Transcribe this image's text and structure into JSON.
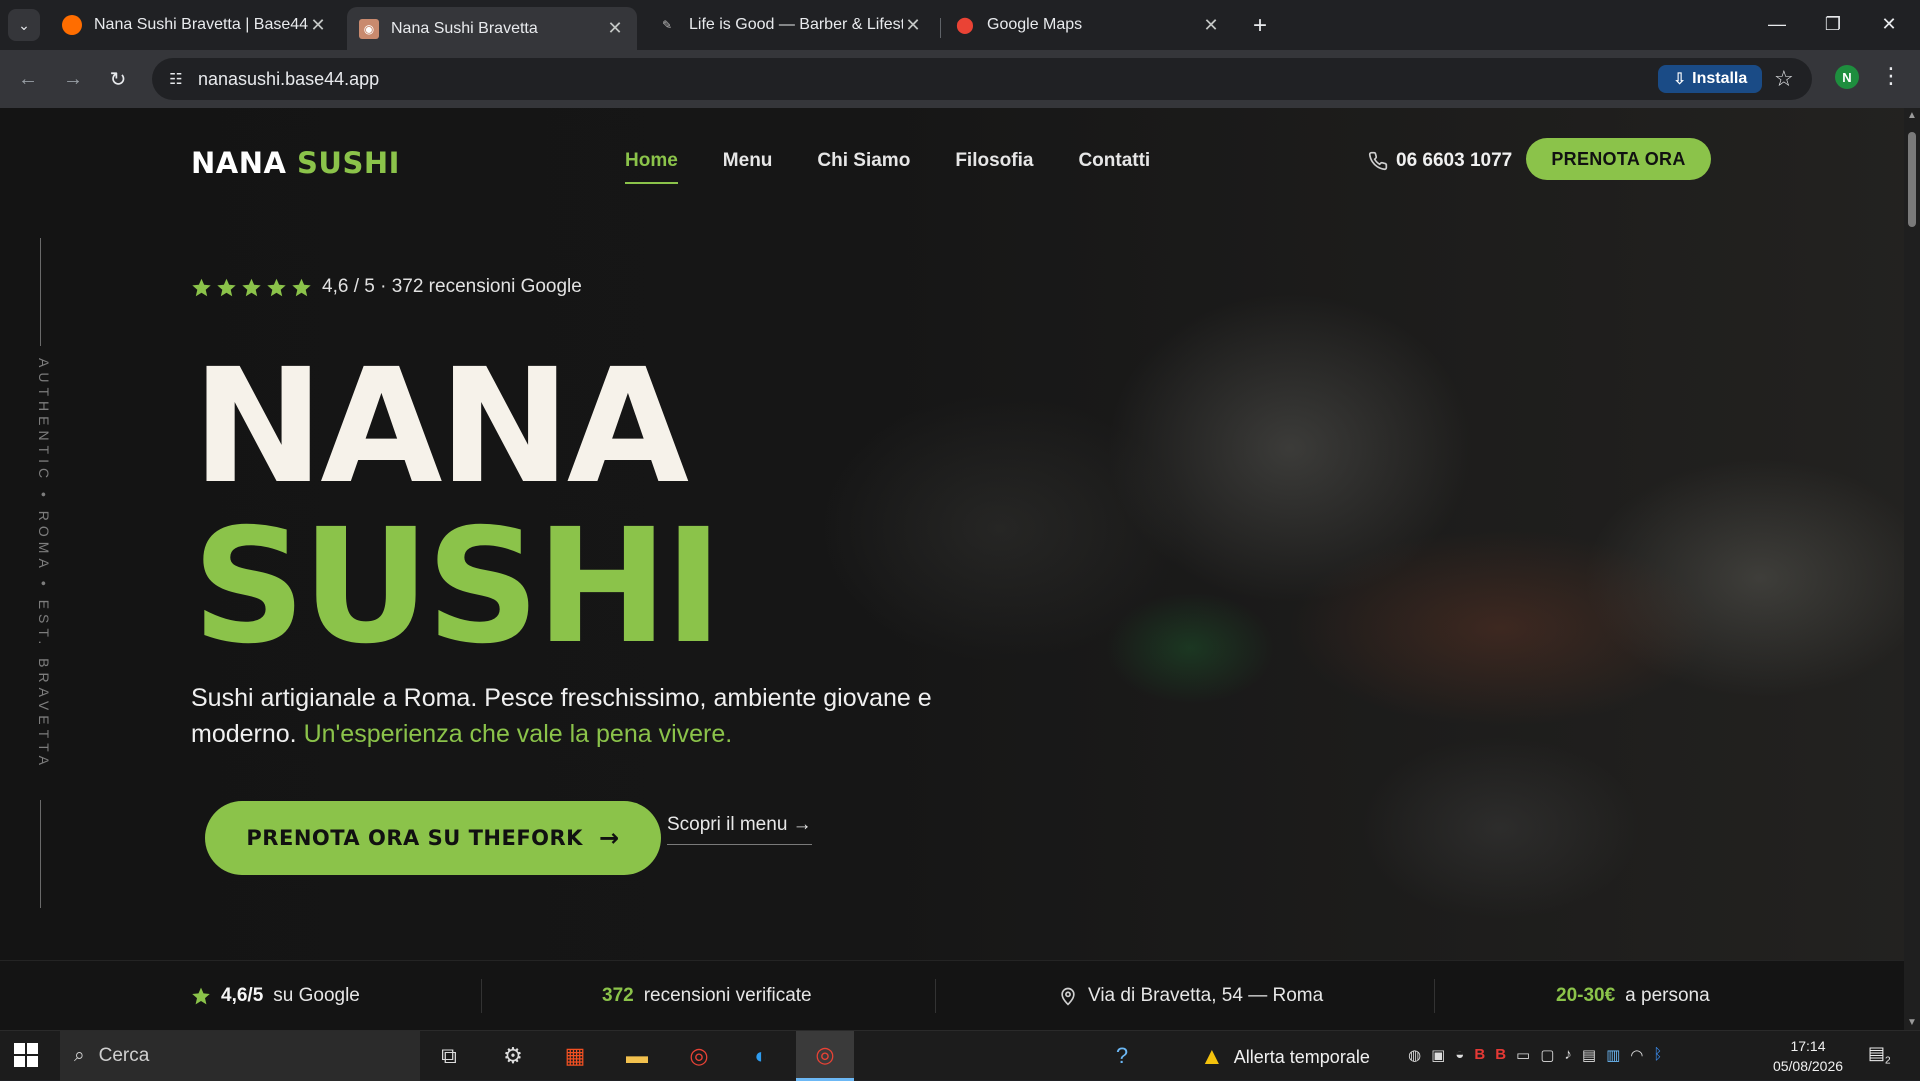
{
  "browser": {
    "tabs": [
      {
        "title": "Nana Sushi Bravetta | Base44",
        "active": false
      },
      {
        "title": "Nana Sushi Bravetta",
        "active": true
      },
      {
        "title": "Life is Good — Barber & Lifestyle",
        "active": false
      },
      {
        "title": "Google Maps",
        "active": false
      }
    ],
    "url": "nanasushi.base44.app",
    "install_label": "Installa",
    "profile_initial": "N"
  },
  "site": {
    "logo_primary": "NANA",
    "logo_accent": "SUSHI",
    "nav": [
      {
        "label": "Home",
        "active": true
      },
      {
        "label": "Menu",
        "active": false
      },
      {
        "label": "Chi Siamo",
        "active": false
      },
      {
        "label": "Filosofia",
        "active": false
      },
      {
        "label": "Contatti",
        "active": false
      }
    ],
    "phone": "06 6603 1077",
    "book_button": "PRENOTA ORA",
    "side_text": "AUTHENTIC • ROMA • EST. BRAVETTA",
    "rating": {
      "value": 4.6,
      "max": 5,
      "stars": 5,
      "text": "4,6 / 5 · 372 recensioni Google"
    },
    "hero_line1": "NANA",
    "hero_line2": "SUSHI",
    "tagline_main": "Sushi artigianale a Roma. Pesce freschissimo, ambiente giovane e moderno. ",
    "tagline_accent": "Un'esperienza che vale la pena vivere.",
    "cta_label": "PRENOTA ORA SU THEFORK",
    "menu_link": "Scopri il menu →",
    "info": {
      "rating_value": "4,6/5",
      "rating_label": "su Google",
      "reviews_value": "372",
      "reviews_label": "recensioni verificate",
      "address": "Via di Bravetta, 54 — Roma",
      "price_value": "20-30€",
      "price_label": "a persona"
    },
    "colors": {
      "accent": "#8bc34a",
      "background": "#141414",
      "hero_white": "#f6f2ea"
    }
  },
  "taskbar": {
    "search_placeholder": "Cerca",
    "weather_text": "Allerta temporale",
    "time": "17:14",
    "date": "05/08/2026",
    "notification_count": "2"
  }
}
